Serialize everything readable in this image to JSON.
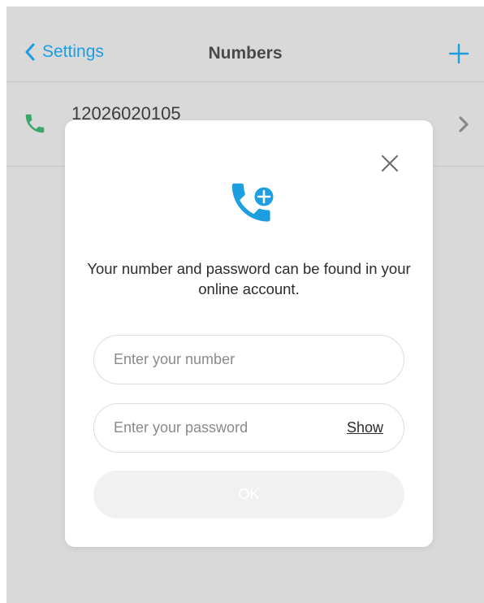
{
  "nav": {
    "back_label": "Settings",
    "title": "Numbers",
    "back_icon": "chevron-left-icon",
    "add_icon": "plus-icon"
  },
  "numbers": [
    {
      "number": "12026020105",
      "icon": "phone-icon",
      "chevron": "chevron-right-icon"
    }
  ],
  "modal": {
    "icon": "phone-plus-icon",
    "close_icon": "close-icon",
    "message": "Your number and password can be found in your online account.",
    "number_field": {
      "value": "",
      "placeholder": "Enter your number"
    },
    "password_field": {
      "value": "",
      "placeholder": "Enter your password"
    },
    "show_label": "Show",
    "ok_label": "OK"
  },
  "colors": {
    "accent": "#1d9ee0",
    "phone_green": "#3ca66b",
    "overlay_background": "#d9d9d9",
    "title_text": "#4a4a4a",
    "ok_disabled": "#f1f1f1"
  }
}
